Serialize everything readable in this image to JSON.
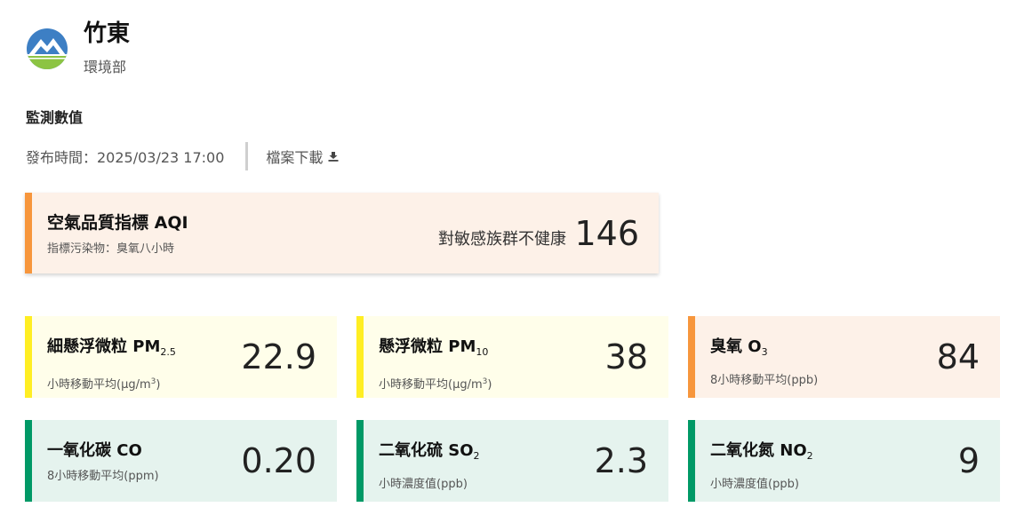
{
  "station": {
    "name": "竹東",
    "agency": "環境部"
  },
  "section_title": "監測數值",
  "publish_time": "發布時間：2025/03/23 17:00",
  "download_label": "檔案下載",
  "aqi": {
    "title": "空氣品質指標 AQI",
    "pollutant": "指標污染物：臭氧八小時",
    "status": "對敏感族群不健康",
    "value": "146",
    "color": "#f7963c"
  },
  "pollutants": [
    {
      "name": "細懸浮微粒 PM",
      "sub": "2.5",
      "unit_pre": "小時移動平均(μg/m",
      "unit_sup": "3",
      "unit_post": ")",
      "value": "22.9",
      "color": "#ffee23"
    },
    {
      "name": "懸浮微粒 PM",
      "sub": "10",
      "unit_pre": "小時移動平均(μg/m",
      "unit_sup": "3",
      "unit_post": ")",
      "value": "38",
      "color": "#ffee23"
    },
    {
      "name": "臭氧 O",
      "sub": "3",
      "unit_pre": "8小時移動平均(ppb)",
      "value": "84",
      "color": "#f7963c"
    },
    {
      "name": "一氧化碳 CO",
      "unit_pre": "8小時移動平均(ppm)",
      "value": "0.20",
      "color": "#009966"
    },
    {
      "name": "二氧化硫 SO",
      "sub": "2",
      "unit_pre": "小時濃度值(ppb)",
      "value": "2.3",
      "color": "#009966"
    },
    {
      "name": "二氧化氮 NO",
      "sub": "2",
      "unit_pre": "小時濃度值(ppb)",
      "value": "9",
      "color": "#009966"
    }
  ]
}
